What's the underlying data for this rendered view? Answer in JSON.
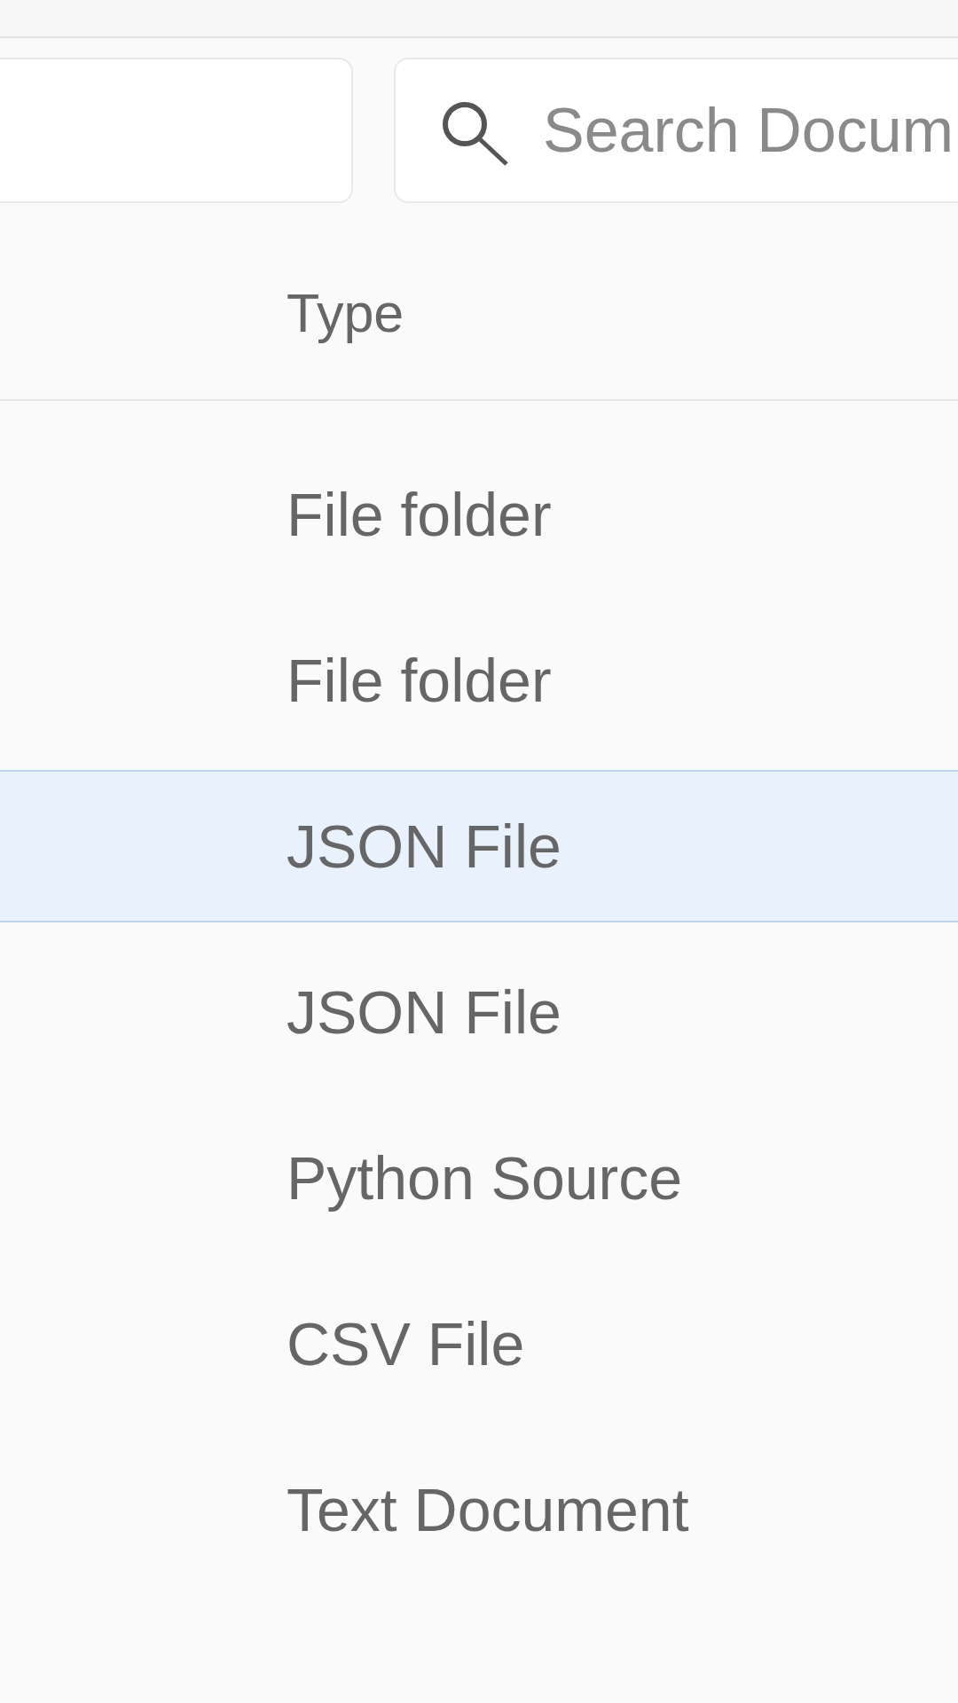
{
  "toolbar": {
    "search": {
      "placeholder": "Search Docum"
    }
  },
  "table": {
    "columns": [
      "Type"
    ],
    "rows": [
      {
        "type": "File folder",
        "selected": false
      },
      {
        "type": "File folder",
        "selected": false
      },
      {
        "type": "JSON File",
        "selected": true
      },
      {
        "type": "JSON File",
        "selected": false
      },
      {
        "type": "Python Source",
        "selected": false
      },
      {
        "type": "CSV File",
        "selected": false
      },
      {
        "type": "Text Document",
        "selected": false
      }
    ]
  }
}
